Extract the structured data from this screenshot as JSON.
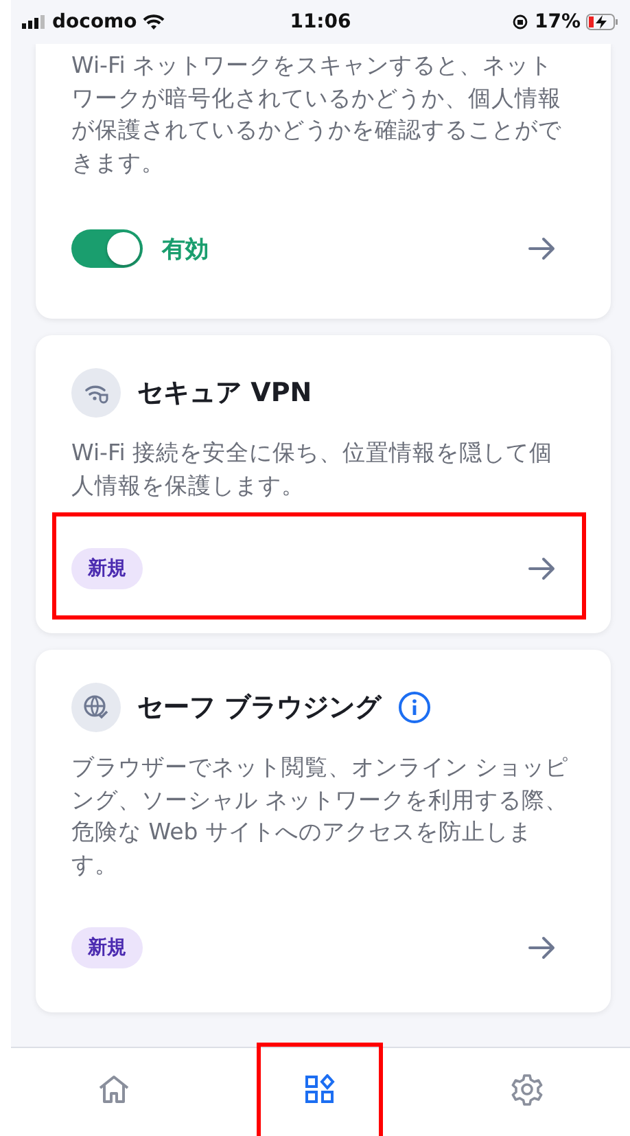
{
  "status_bar": {
    "carrier": "docomo",
    "time": "11:06",
    "battery": "17%"
  },
  "cards": [
    {
      "kind": "toggle",
      "description": "Wi-Fi ネットワークをスキャンすると、ネットワークが暗号化されているかどうか、個人情報が保護されているかどうかを確認することができます。",
      "toggle": {
        "on": true,
        "label": "有効"
      }
    },
    {
      "kind": "feature",
      "title": "セキュア VPN",
      "info": false,
      "description": "Wi-Fi 接続を安全に保ち、位置情報を隠して個人情報を保護します。",
      "badge": "新規",
      "highlighted": true
    },
    {
      "kind": "feature",
      "title": "セーフ ブラウジング",
      "info": true,
      "description": "ブラウザーでネット閲覧、オンライン ショッピング、ソーシャル ネットワークを利用する際、危険な Web サイトへのアクセスを防止します。",
      "badge": "新規",
      "highlighted": false
    }
  ],
  "nav": [
    {
      "selected": false,
      "highlighted": false
    },
    {
      "selected": true,
      "highlighted": true
    },
    {
      "selected": false,
      "highlighted": false
    }
  ]
}
